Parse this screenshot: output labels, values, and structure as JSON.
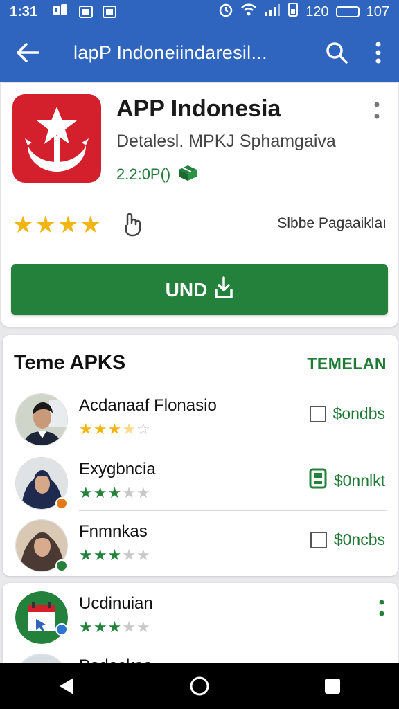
{
  "status_bar": {
    "time": "1:31",
    "signal_text": "120",
    "battery_text": "107"
  },
  "app_bar": {
    "title": "lapP Indoneiindaresil..."
  },
  "app": {
    "name": "APP Indonesia",
    "developer": "Detalesl. MPKJ Sphamgaiva",
    "version": "2.2:0P()",
    "rating": 4,
    "side_label": "Slbbe Pagaaiklaı",
    "install_label": "UND",
    "brand_color": "#d4202c",
    "accent_green": "#23813b",
    "header_blue": "#2f65bf"
  },
  "section": {
    "title": "Teme APKS",
    "link_label": "TEMELAN",
    "items": [
      {
        "name": "Acdanaaf Flonasio",
        "rating": 3.5,
        "star_color": "gold",
        "action_label": "$ondbs",
        "action_icon": "checkbox-icon",
        "badge_color": ""
      },
      {
        "name": "Exygbncia",
        "rating": 3,
        "star_color": "green",
        "action_label": "$0nnlkt",
        "action_icon": "device-icon",
        "badge_color": "#e07a1a"
      },
      {
        "name": "Fnmnkas",
        "rating": 3,
        "star_color": "green",
        "action_label": "$0ncbs",
        "action_icon": "checkbox-icon",
        "badge_color": "#23813b"
      }
    ]
  },
  "bottom_list": {
    "items": [
      {
        "name": "Ucdinuian",
        "rating": 3,
        "badge_color": "#2f74d0"
      },
      {
        "name": "Podackas"
      }
    ]
  }
}
